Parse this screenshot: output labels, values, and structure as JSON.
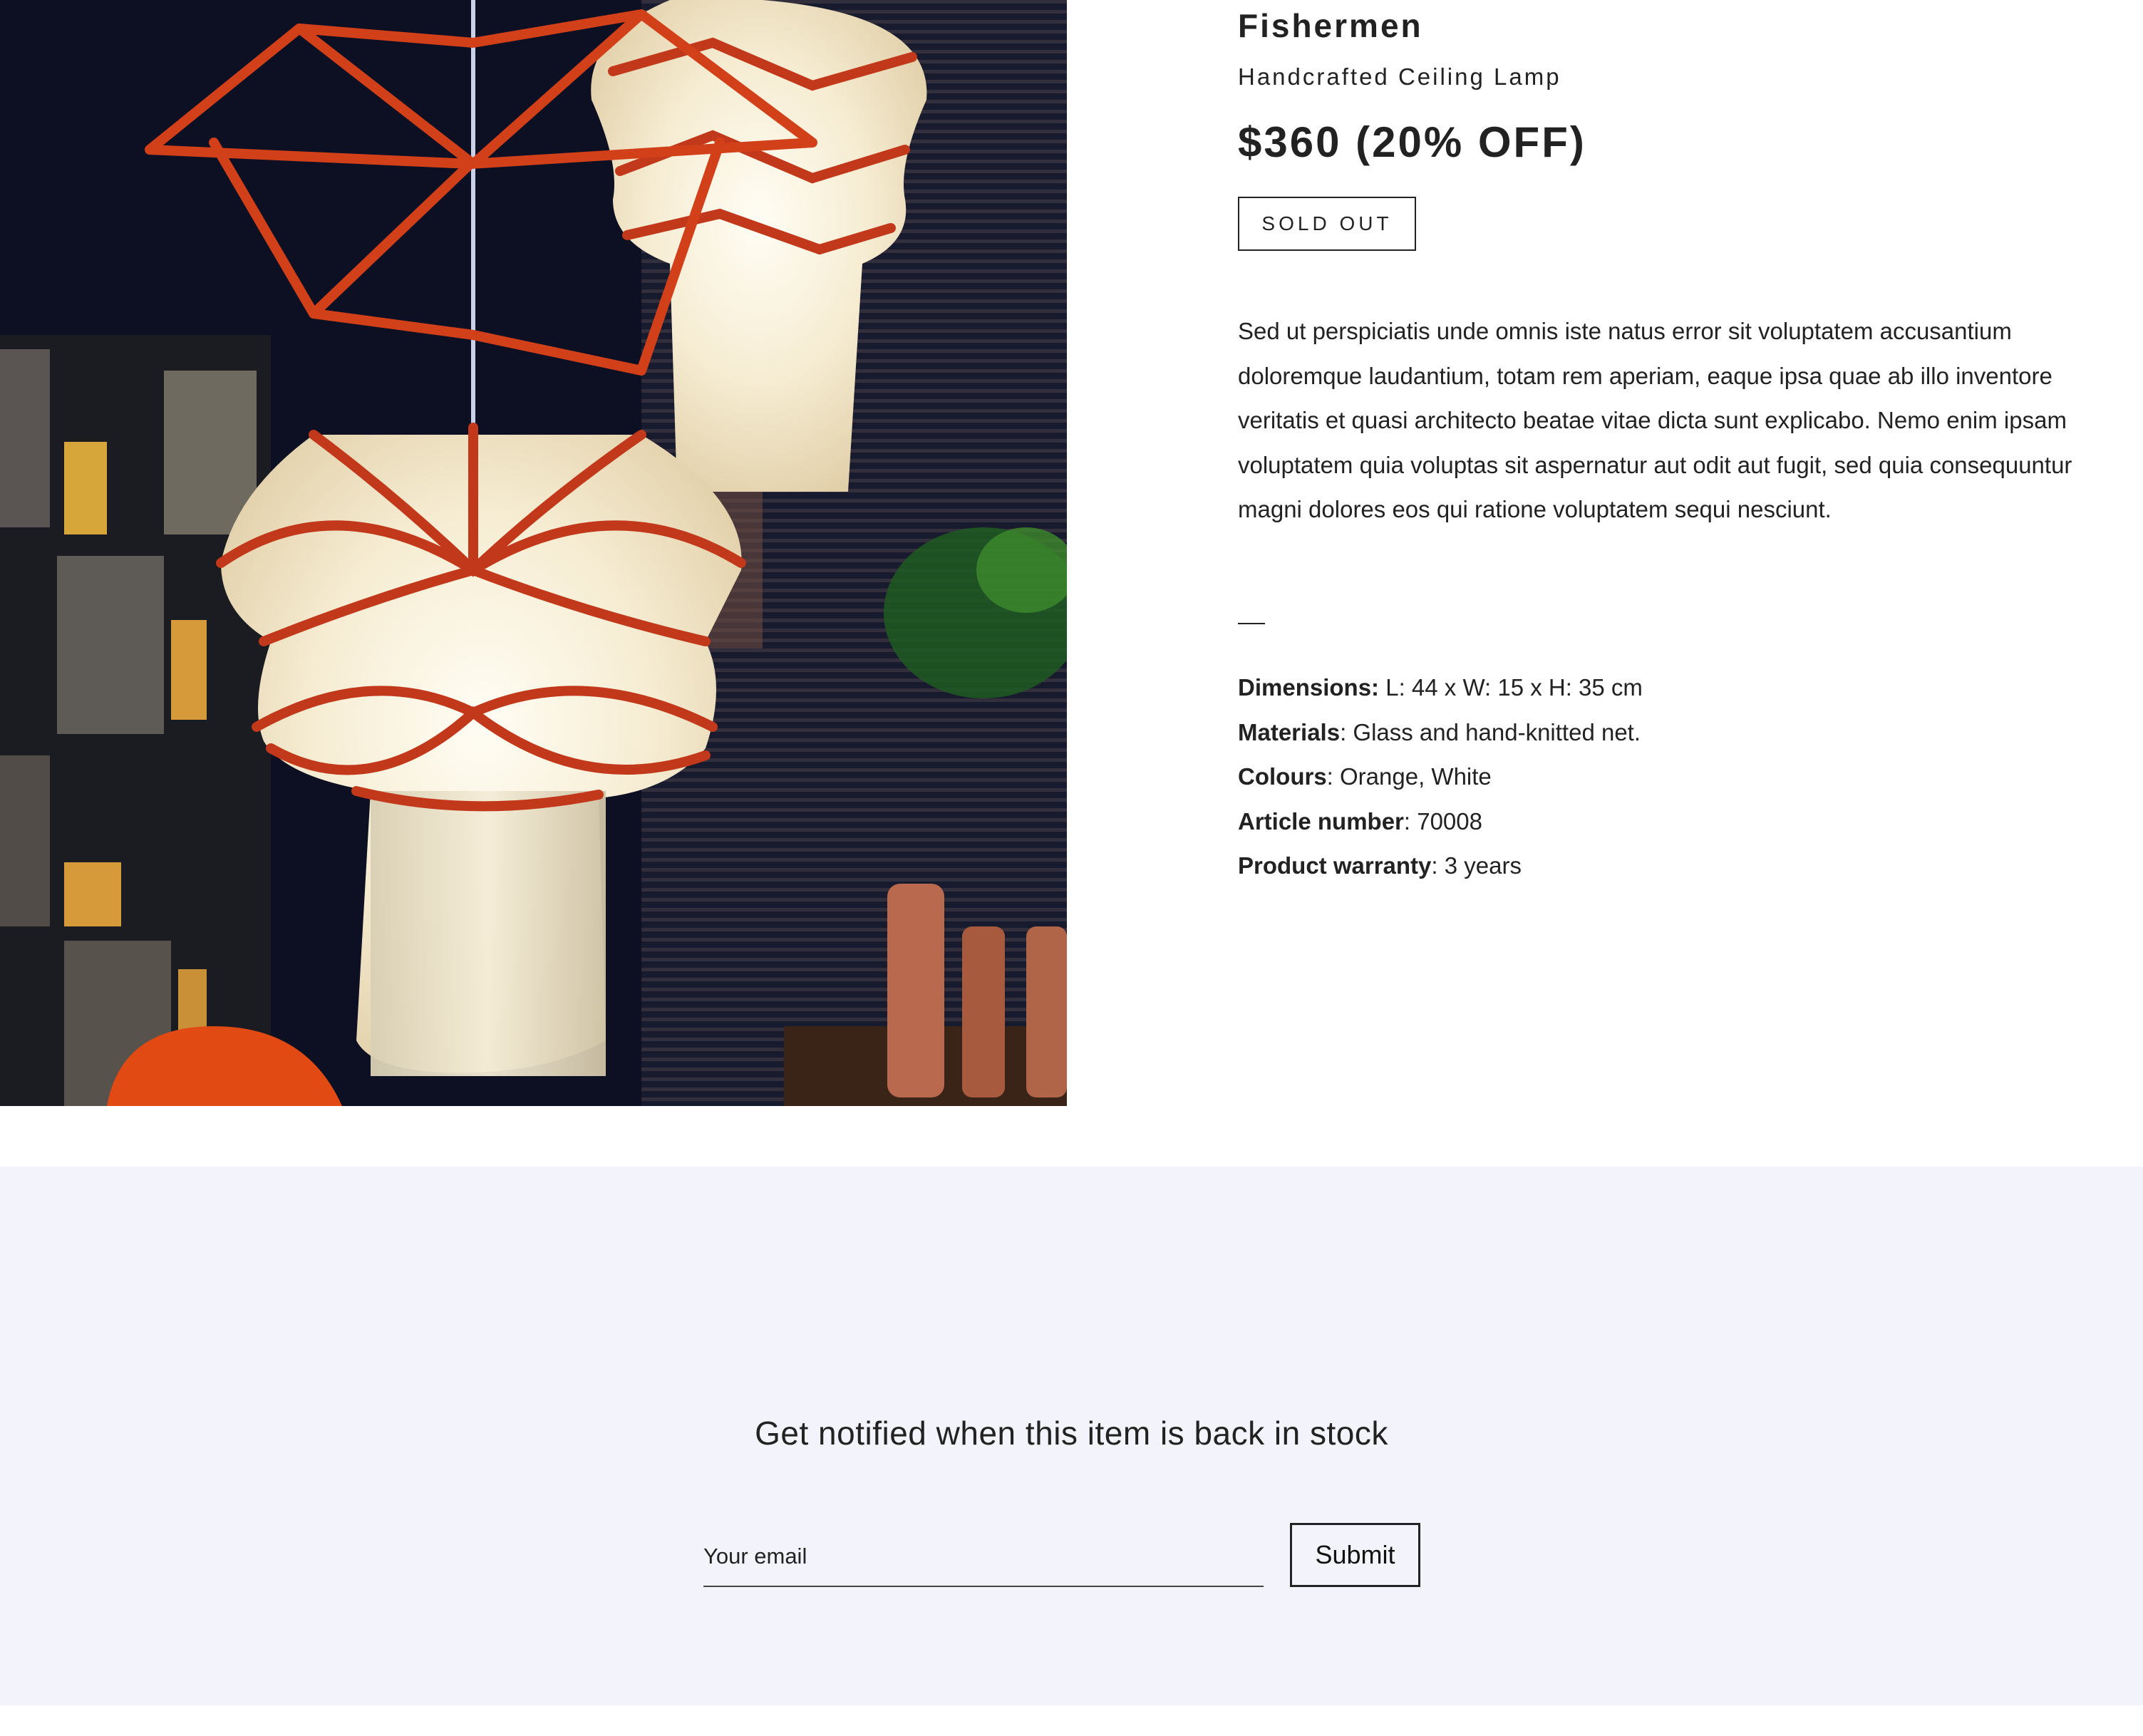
{
  "product": {
    "title": "Fishermen",
    "subtitle": "Handcrafted Ceiling Lamp",
    "price": "$360 (20% OFF)",
    "status_button": "SOLD OUT",
    "description": "Sed ut perspiciatis unde omnis iste natus error sit voluptatem accusantium doloremque laudantium, totam rem aperiam, eaque ipsa quae ab illo inventore veritatis et quasi architecto beatae vitae dicta sunt explicabo. Nemo enim ipsam voluptatem quia voluptas sit aspernatur aut odit aut fugit, sed quia consequuntur magni dolores eos qui ratione voluptatem sequi nesciunt.",
    "separator": "—",
    "specs": [
      {
        "label": "Dimensions:",
        "value": " L: 44 x W: 15 x H: 35 cm"
      },
      {
        "label": "Materials",
        "value": ": Glass and hand-knitted net."
      },
      {
        "label": "Colours",
        "value": ": Orange, White"
      },
      {
        "label": "Article number",
        "value": ": 70008"
      },
      {
        "label": "Product warranty",
        "value": ": 3 years"
      }
    ]
  },
  "notify": {
    "heading": "Get notified when this item is back in stock",
    "email_placeholder": "Your email",
    "submit_label": "Submit"
  },
  "colors": {
    "text": "#222222",
    "notify_background": "#f3f4fb",
    "photo_background": "#0d0f22",
    "lamp_net": "#d2401a",
    "lamp_glass": "#f3ead2"
  }
}
